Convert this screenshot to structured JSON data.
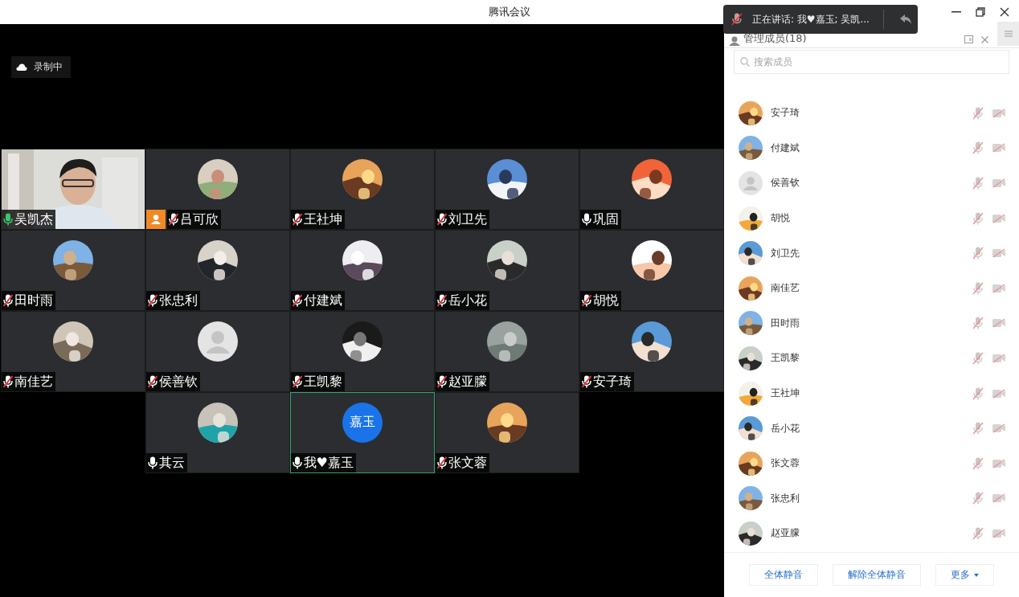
{
  "window": {
    "title": "腾讯会议"
  },
  "recording": {
    "label": "录制中"
  },
  "toast": {
    "text": "正在讲话: 我♥嘉玉; 吴凯..."
  },
  "tiles": [
    {
      "name": "吴凯杰",
      "muted": false,
      "speaking": true,
      "kind": "video",
      "host": false,
      "highlighted": false
    },
    {
      "name": "吕可欣",
      "muted": true,
      "speaking": false,
      "kind": "picture",
      "host": true,
      "highlighted": false
    },
    {
      "name": "王社坤",
      "muted": true,
      "speaking": false,
      "kind": "picture",
      "host": false,
      "highlighted": false
    },
    {
      "name": "刘卫先",
      "muted": true,
      "speaking": false,
      "kind": "picture",
      "host": false,
      "highlighted": false
    },
    {
      "name": "巩固",
      "muted": false,
      "speaking": false,
      "kind": "picture",
      "host": false,
      "highlighted": false
    },
    {
      "name": "田时雨",
      "muted": true,
      "speaking": false,
      "kind": "picture",
      "host": false,
      "highlighted": false
    },
    {
      "name": "张忠利",
      "muted": true,
      "speaking": false,
      "kind": "picture",
      "host": false,
      "highlighted": false
    },
    {
      "name": "付建斌",
      "muted": true,
      "speaking": false,
      "kind": "picture",
      "host": false,
      "highlighted": false
    },
    {
      "name": "岳小花",
      "muted": true,
      "speaking": false,
      "kind": "picture",
      "host": false,
      "highlighted": false
    },
    {
      "name": "胡悦",
      "muted": true,
      "speaking": false,
      "kind": "picture",
      "host": false,
      "highlighted": false
    },
    {
      "name": "南佳艺",
      "muted": true,
      "speaking": false,
      "kind": "picture",
      "host": false,
      "highlighted": false
    },
    {
      "name": "侯善钦",
      "muted": true,
      "speaking": false,
      "kind": "default",
      "host": false,
      "highlighted": false
    },
    {
      "name": "王凯黎",
      "muted": true,
      "speaking": false,
      "kind": "picture",
      "host": false,
      "highlighted": false
    },
    {
      "name": "赵亚朦",
      "muted": true,
      "speaking": false,
      "kind": "picture",
      "host": false,
      "highlighted": false
    },
    {
      "name": "安子琦",
      "muted": true,
      "speaking": false,
      "kind": "picture",
      "host": false,
      "highlighted": false
    },
    {
      "name": "其云",
      "muted": false,
      "speaking": false,
      "kind": "picture",
      "host": false,
      "highlighted": false
    },
    {
      "name": "我♥嘉玉",
      "muted": false,
      "speaking": false,
      "kind": "initials",
      "initials": "嘉玉",
      "host": false,
      "highlighted": true
    },
    {
      "name": "张文蓉",
      "muted": true,
      "speaking": false,
      "kind": "picture",
      "host": false,
      "highlighted": false
    }
  ],
  "panel": {
    "title": "管理成员(18)",
    "search": {
      "placeholder": "搜索成员"
    },
    "members": [
      {
        "name": "安子琦",
        "kind": "picture",
        "mic_muted": true,
        "camera_off": true
      },
      {
        "name": "付建斌",
        "kind": "picture",
        "mic_muted": true,
        "camera_off": true
      },
      {
        "name": "侯善钦",
        "kind": "default",
        "mic_muted": true,
        "camera_off": true
      },
      {
        "name": "胡悦",
        "kind": "picture",
        "mic_muted": true,
        "camera_off": true
      },
      {
        "name": "刘卫先",
        "kind": "picture",
        "mic_muted": true,
        "camera_off": true
      },
      {
        "name": "南佳艺",
        "kind": "picture",
        "mic_muted": true,
        "camera_off": true
      },
      {
        "name": "田时雨",
        "kind": "picture",
        "mic_muted": true,
        "camera_off": true
      },
      {
        "name": "王凯黎",
        "kind": "picture",
        "mic_muted": true,
        "camera_off": true
      },
      {
        "name": "王社坤",
        "kind": "picture",
        "mic_muted": true,
        "camera_off": true
      },
      {
        "name": "岳小花",
        "kind": "picture",
        "mic_muted": true,
        "camera_off": true
      },
      {
        "name": "张文蓉",
        "kind": "picture",
        "mic_muted": true,
        "camera_off": true
      },
      {
        "name": "张忠利",
        "kind": "picture",
        "mic_muted": true,
        "camera_off": true
      },
      {
        "name": "赵亚朦",
        "kind": "picture",
        "mic_muted": true,
        "camera_off": true
      }
    ],
    "buttons": [
      {
        "label": "全体静音",
        "kind": "plain"
      },
      {
        "label": "解除全体静音",
        "kind": "plain"
      },
      {
        "label": "更多",
        "kind": "dropdown"
      }
    ]
  }
}
